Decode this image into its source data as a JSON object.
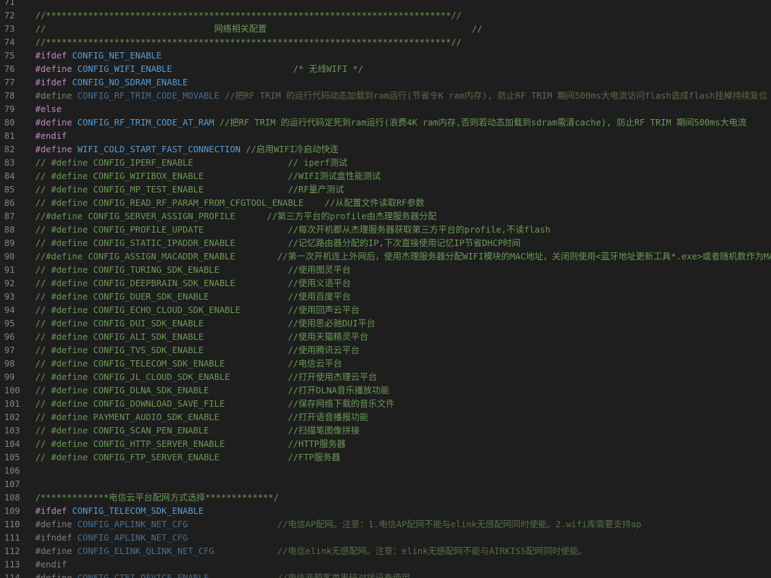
{
  "colors": {
    "background": "#1e1e1e",
    "line_number": "#858585",
    "directive": "#c586c0",
    "macro": "#569cd6",
    "comment": "#6a9955",
    "inactive_directive": "#7f7f7f",
    "inactive_macro": "#4b6e8e",
    "inactive_comment": "#556f47"
  },
  "lines": [
    {
      "n": "71",
      "tokens": []
    },
    {
      "n": "72",
      "tokens": [
        {
          "t": "//*****************************************************************************//",
          "c": "comment"
        }
      ]
    },
    {
      "n": "73",
      "tokens": [
        {
          "t": "//                                网络相关配置                                       //",
          "c": "comment"
        }
      ]
    },
    {
      "n": "74",
      "tokens": [
        {
          "t": "//*****************************************************************************//",
          "c": "comment"
        }
      ]
    },
    {
      "n": "75",
      "tokens": [
        {
          "t": "#ifdef",
          "c": "dir"
        },
        {
          "t": " CONFIG_NET_ENABLE",
          "c": "macro"
        }
      ]
    },
    {
      "n": "76",
      "tokens": [
        {
          "t": "#define",
          "c": "dir"
        },
        {
          "t": " CONFIG_WIFI_ENABLE",
          "c": "macro"
        },
        {
          "t": "                       /* 无线WIFI */",
          "c": "comment"
        }
      ]
    },
    {
      "n": "77",
      "tokens": [
        {
          "t": "#ifdef",
          "c": "dir"
        },
        {
          "t": " CONFIG_NO_SDRAM_ENABLE",
          "c": "macro"
        }
      ]
    },
    {
      "n": "78",
      "tokens": [
        {
          "t": "#define",
          "c": "dim"
        },
        {
          "t": " CONFIG_RF_TRIM_CODE_MOVABLE",
          "c": "dimmacro"
        },
        {
          "t": " //把RF TRIM 的运行代码动态加载到ram运行(节省令K ram内存), 防止RF TRIM 期间500ms大电流访问flash造成flash挂掉持续复位",
          "c": "dimcomment"
        }
      ]
    },
    {
      "n": "79",
      "tokens": [
        {
          "t": "#else",
          "c": "dir"
        }
      ]
    },
    {
      "n": "80",
      "tokens": [
        {
          "t": "#define",
          "c": "dir"
        },
        {
          "t": " CONFIG_RF_TRIM_CODE_AT_RAM",
          "c": "macro"
        },
        {
          "t": " //把RF TRIM 的运行代码定死到ram运行(浪费4K ram内存,否则若动态加载到sdram需清cache), 防止RF TRIM 期间500ms大电流",
          "c": "comment"
        }
      ]
    },
    {
      "n": "81",
      "tokens": [
        {
          "t": "#endif",
          "c": "dir"
        }
      ]
    },
    {
      "n": "82",
      "tokens": [
        {
          "t": "#define",
          "c": "dir"
        },
        {
          "t": " WIFI_COLD_START_FAST_CONNECTION",
          "c": "macro"
        },
        {
          "t": " //启用WIFI冷启动快连",
          "c": "comment"
        }
      ]
    },
    {
      "n": "83",
      "tokens": [
        {
          "t": "// #define CONFIG_IPERF_ENABLE                  // iperf测试",
          "c": "comment"
        }
      ]
    },
    {
      "n": "84",
      "tokens": [
        {
          "t": "// #define CONFIG_WIFIBOX_ENABLE                //WIFI测试盒性能测试",
          "c": "comment"
        }
      ]
    },
    {
      "n": "85",
      "tokens": [
        {
          "t": "// #define CONFIG_MP_TEST_ENABLE                //RF量产测试",
          "c": "comment"
        }
      ]
    },
    {
      "n": "86",
      "tokens": [
        {
          "t": "// #define CONFIG_READ_RF_PARAM_FROM_CFGTOOL_ENABLE    //从配置文件读取RF参数",
          "c": "comment"
        }
      ]
    },
    {
      "n": "87",
      "tokens": [
        {
          "t": "//#define CONFIG_SERVER_ASSIGN_PROFILE      //第三方平台的profile由杰理服务器分配",
          "c": "comment"
        }
      ]
    },
    {
      "n": "88",
      "tokens": [
        {
          "t": "// #define CONFIG_PROFILE_UPDATE                //每次开机都从杰理服务器获取第三方平台的profile,不读flash",
          "c": "comment"
        }
      ]
    },
    {
      "n": "89",
      "tokens": [
        {
          "t": "// #define CONFIG_STATIC_IPADDR_ENABLE          //记忆路由器分配的IP,下次直接使用记忆IP节省DHCP时间",
          "c": "comment"
        }
      ]
    },
    {
      "n": "90",
      "tokens": [
        {
          "t": "//#define CONFIG_ASSIGN_MACADDR_ENABLE        //第一次开机连上外网后，使用杰理服务器分配WIFI模块的MAC地址，关闭则使用<蓝牙地址更新工具*.exe>或者随机数作为MAC地址",
          "c": "comment"
        }
      ]
    },
    {
      "n": "91",
      "tokens": [
        {
          "t": "// #define CONFIG_TURING_SDK_ENABLE             //使用图灵平台",
          "c": "comment"
        }
      ]
    },
    {
      "n": "92",
      "tokens": [
        {
          "t": "// #define CONFIG_DEEPBRAIN_SDK_ENABLE          //使用义语平台",
          "c": "comment"
        }
      ]
    },
    {
      "n": "93",
      "tokens": [
        {
          "t": "// #define CONFIG_DUER_SDK_ENABLE               //使用百度平台",
          "c": "comment"
        }
      ]
    },
    {
      "n": "94",
      "tokens": [
        {
          "t": "// #define CONFIG_ECHO_CLOUD_SDK_ENABLE         //使用回声云平台",
          "c": "comment"
        }
      ]
    },
    {
      "n": "95",
      "tokens": [
        {
          "t": "// #define CONFIG_DUI_SDK_ENABLE                //使用思必驰DUI平台",
          "c": "comment"
        }
      ]
    },
    {
      "n": "96",
      "tokens": [
        {
          "t": "// #define CONFIG_ALI_SDK_ENABLE                //使用天猫精灵平台",
          "c": "comment"
        }
      ]
    },
    {
      "n": "97",
      "tokens": [
        {
          "t": "// #define CONFIG_TVS_SDK_ENABLE                //使用腾讯云平台",
          "c": "comment"
        }
      ]
    },
    {
      "n": "98",
      "tokens": [
        {
          "t": "// #define CONFIG_TELECOM_SDK_ENABLE            //电信云平台",
          "c": "comment"
        }
      ]
    },
    {
      "n": "99",
      "tokens": [
        {
          "t": "// #define CONFIG_JL_CLOUD_SDK_ENABLE           //打开使用杰理云平台",
          "c": "comment"
        }
      ]
    },
    {
      "n": "100",
      "tokens": [
        {
          "t": "// #define CONFIG_DLNA_SDK_ENABLE               //打开DLNA音乐播放功能",
          "c": "comment"
        }
      ]
    },
    {
      "n": "101",
      "tokens": [
        {
          "t": "// #define CONFIG_DOWNLOAD_SAVE_FILE            //保存网络下载的音乐文件",
          "c": "comment"
        }
      ]
    },
    {
      "n": "102",
      "tokens": [
        {
          "t": "// #define PAYMENT_AUDIO_SDK_ENABLE             //打开语音播报功能",
          "c": "comment"
        }
      ]
    },
    {
      "n": "103",
      "tokens": [
        {
          "t": "// #define CONFIG_SCAN_PEN_ENABLE               //扫描笔图像拼接",
          "c": "comment"
        }
      ]
    },
    {
      "n": "104",
      "tokens": [
        {
          "t": "// #define CONFIG_HTTP_SERVER_ENABLE            //HTTP服务器",
          "c": "comment"
        }
      ]
    },
    {
      "n": "105",
      "tokens": [
        {
          "t": "// #define CONFIG_FTP_SERVER_ENABLE             //FTP服务器",
          "c": "comment"
        }
      ]
    },
    {
      "n": "106",
      "tokens": []
    },
    {
      "n": "107",
      "tokens": []
    },
    {
      "n": "108",
      "tokens": [
        {
          "t": "/*************电信云平台配网方式选择*************/",
          "c": "comment"
        }
      ]
    },
    {
      "n": "109",
      "tokens": [
        {
          "t": "#ifdef",
          "c": "dir"
        },
        {
          "t": " CONFIG_TELECOM_SDK_ENABLE",
          "c": "macro"
        }
      ]
    },
    {
      "n": "110",
      "tokens": [
        {
          "t": "#define",
          "c": "dim"
        },
        {
          "t": " CONFIG_APLINK_NET_CFG",
          "c": "dimmacro"
        },
        {
          "t": "                 //电信AP配网。注意：1.电信AP配网不能与elink无感配网同时使能。2.wifi库需要支持ap",
          "c": "dimcomment"
        }
      ]
    },
    {
      "n": "111",
      "tokens": [
        {
          "t": "#ifndef",
          "c": "dim"
        },
        {
          "t": " CONFIG_APLINK_NET_CFG",
          "c": "dimmacro"
        }
      ]
    },
    {
      "n": "112",
      "tokens": [
        {
          "t": "#define",
          "c": "dim"
        },
        {
          "t": " CONFIG_ELINK_QLINK_NET_CFG",
          "c": "dimmacro"
        },
        {
          "t": "            //电信elink无感配网。注意：elink无感配网不能与AIRKISS配网同时使能。",
          "c": "dimcomment"
        }
      ]
    },
    {
      "n": "113",
      "tokens": [
        {
          "t": "#endif",
          "c": "dim"
        }
      ]
    },
    {
      "n": "114",
      "tokens": [
        {
          "t": "#define",
          "c": "dim"
        },
        {
          "t": " CONFIG_CTEI_DEVICE_ENABLE",
          "c": "dimmacro"
        },
        {
          "t": "             //电信非蓜客类串码对接设备使用",
          "c": "dimcomment"
        }
      ]
    }
  ]
}
